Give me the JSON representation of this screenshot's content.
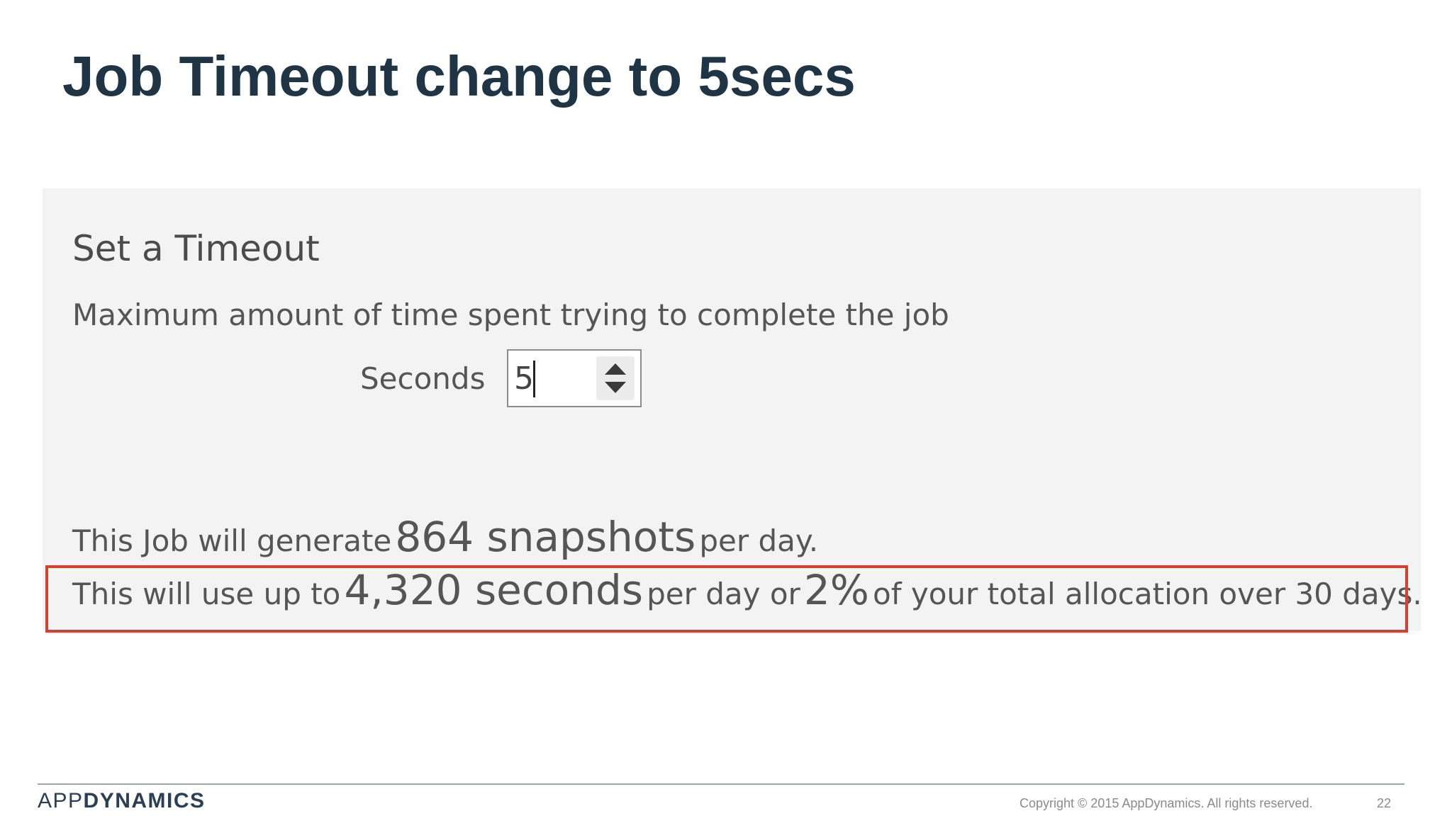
{
  "slide": {
    "title": "Job Timeout change to 5secs",
    "page_number": "22",
    "copyright": "Copyright © 2015 AppDynamics. All rights reserved."
  },
  "logo": {
    "light": "APP",
    "bold": "DYNAMICS"
  },
  "panel": {
    "heading": "Set a Timeout",
    "description": "Maximum amount of time spent trying to complete the job",
    "seconds_label": "Seconds",
    "seconds_value": "5",
    "snapshots_line": {
      "prefix": "This Job will generate",
      "count": "864 snapshots",
      "suffix": "per day."
    },
    "usage_line": {
      "prefix": "This will use up to",
      "seconds": "4,320 seconds",
      "middle": "per day or",
      "percent": "2%",
      "suffix": "of your total allocation over 30 days."
    }
  },
  "colors": {
    "title": "#1f3444",
    "highlight": "#d9402b",
    "panel_bg": "#f3f3f4"
  },
  "icons": [
    "spinner-up-icon",
    "spinner-down-icon"
  ]
}
